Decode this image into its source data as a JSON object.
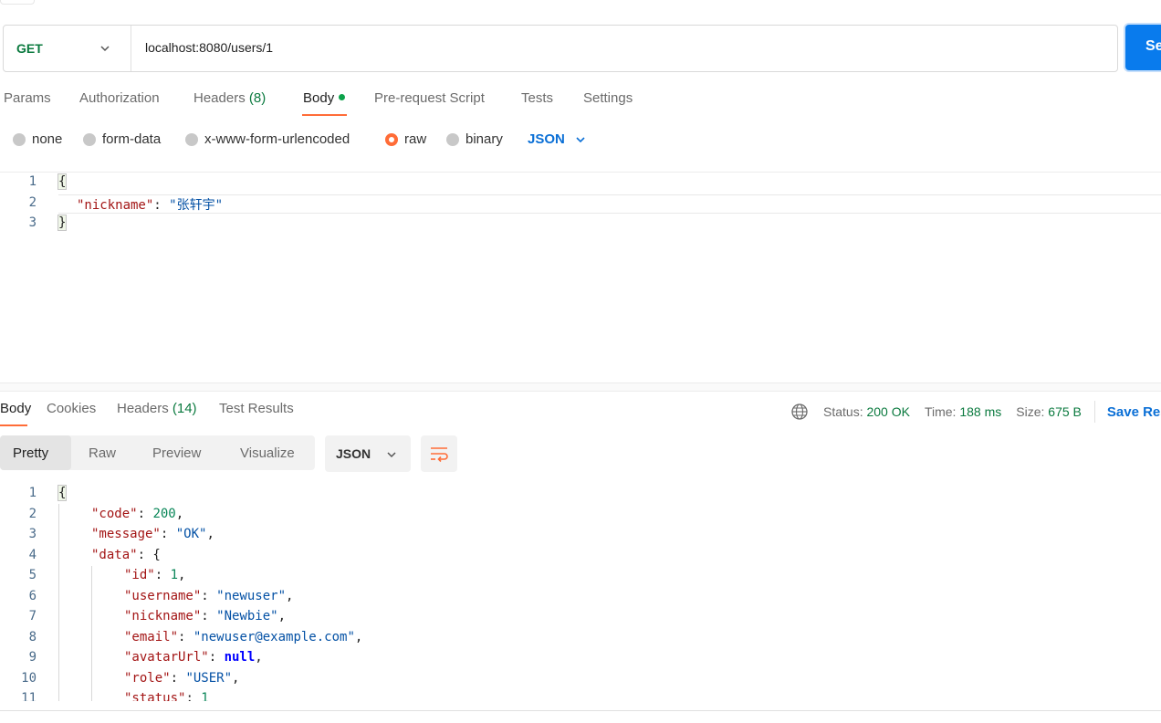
{
  "request": {
    "method": "GET",
    "url": "localhost:8080/users/1",
    "send_label": "Send",
    "tabs": [
      {
        "label": "Params"
      },
      {
        "label": "Authorization"
      },
      {
        "label": "Headers",
        "count": "(8)"
      },
      {
        "label": "Body",
        "active": true
      },
      {
        "label": "Pre-request Script"
      },
      {
        "label": "Tests"
      },
      {
        "label": "Settings"
      }
    ],
    "body_types": [
      "none",
      "form-data",
      "x-www-form-urlencoded",
      "raw",
      "binary"
    ],
    "selected_body_type": "raw",
    "body_language": "JSON",
    "body_lines": [
      {
        "num": "1"
      },
      {
        "num": "2",
        "key": "\"nickname\"",
        "value": "\"张轩宇\""
      },
      {
        "num": "3"
      }
    ]
  },
  "response": {
    "tabs": [
      {
        "label": "Body",
        "active": true
      },
      {
        "label": "Cookies"
      },
      {
        "label": "Headers",
        "count": "(14)"
      },
      {
        "label": "Test Results"
      }
    ],
    "status_label": "Status:",
    "status_value": "200 OK",
    "time_label": "Time:",
    "time_value": "188 ms",
    "size_label": "Size:",
    "size_value": "675 B",
    "save_label": "Save Response",
    "views": [
      "Pretty",
      "Raw",
      "Preview",
      "Visualize"
    ],
    "active_view": "Pretty",
    "format": "JSON",
    "line_numbers": [
      "1",
      "2",
      "3",
      "4",
      "5",
      "6",
      "7",
      "8",
      "9",
      "10",
      "11"
    ],
    "fields": {
      "code_key": "\"code\"",
      "code_val": "200",
      "message_key": "\"message\"",
      "message_val": "\"OK\"",
      "data_key": "\"data\"",
      "id_key": "\"id\"",
      "id_val": "1",
      "username_key": "\"username\"",
      "username_val": "\"newuser\"",
      "nickname_key": "\"nickname\"",
      "nickname_val": "\"Newbie\"",
      "email_key": "\"email\"",
      "email_val": "\"newuser@example.com\"",
      "avatar_key": "\"avatarUrl\"",
      "avatar_val": "null",
      "role_key": "\"role\"",
      "role_val": "\"USER\"",
      "status_key": "\"status\"",
      "status_val": "1"
    }
  },
  "colors": {
    "accent": "#ff6c37",
    "send": "#097bed",
    "method": "#0b7a3f",
    "link": "#0a6fd6"
  },
  "icons": {
    "method_chevron": "chevron-down-icon",
    "format_chevron": "chevron-down-icon",
    "globe": "globe-icon",
    "wrap": "wrap-lines-icon"
  }
}
